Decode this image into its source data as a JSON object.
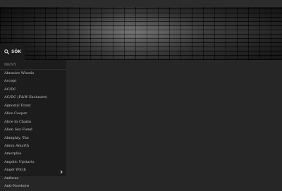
{
  "search": {
    "label": "SÖK"
  },
  "sidebar": {
    "heading": "MENY",
    "artists": [
      "Abrasive Wheels",
      "Accept",
      "AC/DC",
      "AC/DC (F&W Exclusive)",
      "Agnostic Front",
      "Alice Cooper",
      "Alice In Chains",
      "Alien Sex Fiend",
      "Almighty, The",
      "Amon Amarth",
      "Amorphis",
      "Angelic Upstarts",
      "Angel Witch",
      "Anthrax",
      "Anti-Nowhere"
    ]
  },
  "icons": {
    "search": "search-icon",
    "scroll": "chevron-right-icon"
  }
}
